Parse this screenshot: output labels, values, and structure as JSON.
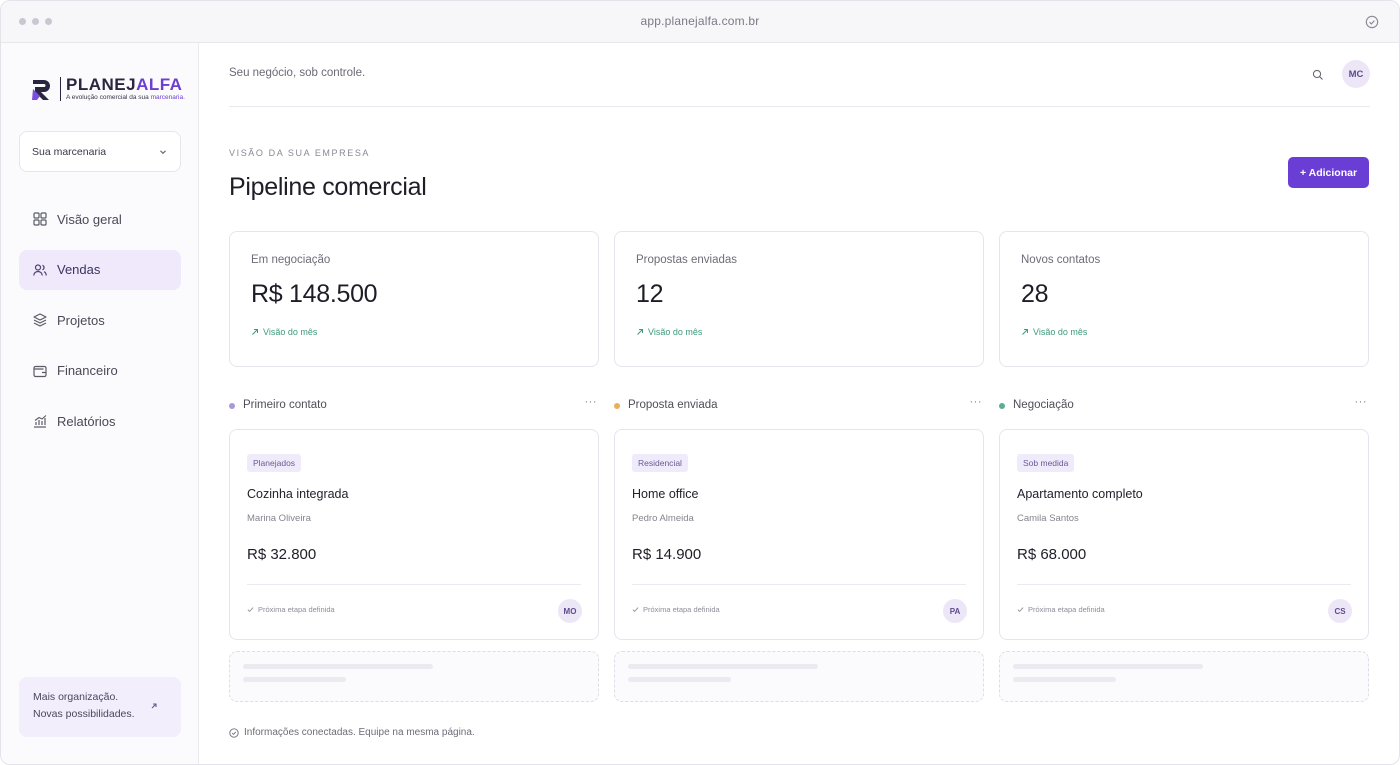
{
  "window": {
    "url": "app.planejalfa.com.br"
  },
  "brand": {
    "name_part1": "PLANEJ",
    "name_part2": "ALFA",
    "tagline_part1": "A evolução comercial da sua ",
    "tagline_part2": "marcenaria.",
    "accent_color": "#6a3ed4"
  },
  "sidebar": {
    "company_select": "Sua marcenaria",
    "items": [
      {
        "label": "Visão geral",
        "icon": "grid-icon",
        "active": false
      },
      {
        "label": "Vendas",
        "icon": "users-icon",
        "active": true
      },
      {
        "label": "Projetos",
        "icon": "layers-icon",
        "active": false
      },
      {
        "label": "Financeiro",
        "icon": "wallet-icon",
        "active": false
      },
      {
        "label": "Relatórios",
        "icon": "chart-icon",
        "active": false
      }
    ],
    "promo": {
      "line1": "Mais organização.",
      "line2": "Novas possibilidades."
    }
  },
  "header": {
    "tagline": "Seu negócio, sob controle.",
    "avatar_initials": "MC"
  },
  "page": {
    "eyebrow": "VISÃO DA SUA EMPRESA",
    "title": "Pipeline comercial",
    "add_button": "+ Adicionar"
  },
  "stats": [
    {
      "label": "Em negociação",
      "value": "R$ 148.500",
      "foot": "Visão do mês"
    },
    {
      "label": "Propostas enviadas",
      "value": "12",
      "foot": "Visão do mês"
    },
    {
      "label": "Novos contatos",
      "value": "28",
      "foot": "Visão do mês"
    }
  ],
  "columns": [
    {
      "title": "Primeiro contato",
      "dot_color": "#a99ad6",
      "more": "···",
      "card": {
        "tag": "Planejados",
        "title": "Cozinha integrada",
        "client": "Marina Oliveira",
        "value": "R$ 32.800",
        "foot": "Próxima etapa definida",
        "initials": "MO"
      }
    },
    {
      "title": "Proposta enviada",
      "dot_color": "#e9b057",
      "more": "···",
      "card": {
        "tag": "Residencial",
        "title": "Home office",
        "client": "Pedro Almeida",
        "value": "R$ 14.900",
        "foot": "Próxima etapa definida",
        "initials": "PA"
      }
    },
    {
      "title": "Negociação",
      "dot_color": "#56b08e",
      "more": "···",
      "card": {
        "tag": "Sob medida",
        "title": "Apartamento completo",
        "client": "Camila Santos",
        "value": "R$ 68.000",
        "foot": "Próxima etapa definida",
        "initials": "CS"
      }
    }
  ],
  "footer": {
    "note": "Informações conectadas. Equipe na mesma página."
  }
}
